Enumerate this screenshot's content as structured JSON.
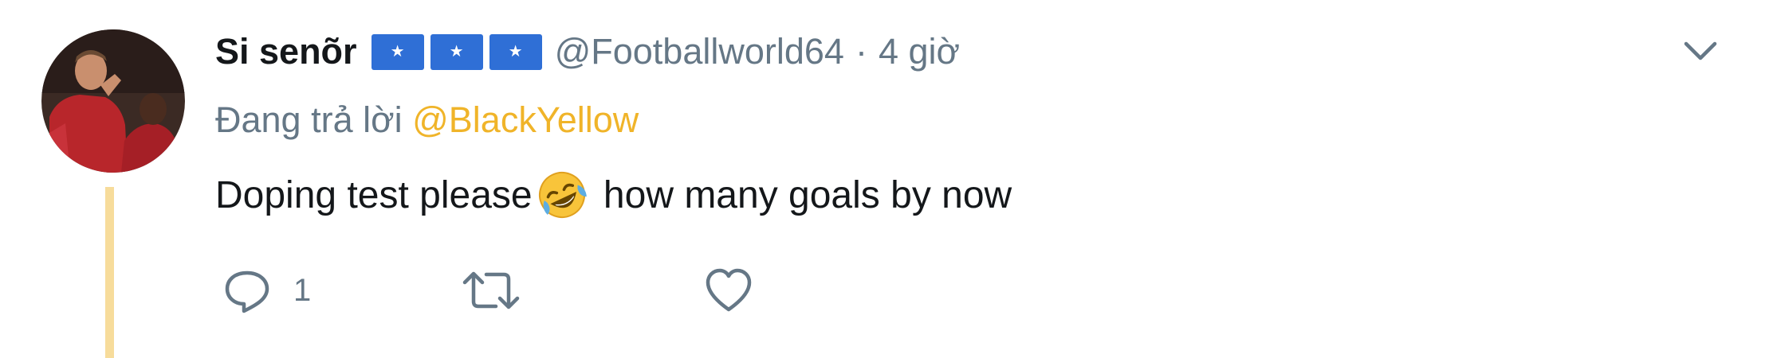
{
  "tweet": {
    "display_name": "Si senõr",
    "badges": [
      "★",
      "★",
      "★"
    ],
    "handle": "@Footballworld64",
    "separator": "·",
    "time": "4 giờ",
    "reply_prefix": "Đang trả lời ",
    "reply_mention": "@BlackYellow",
    "text_before_emoji": "Doping test please",
    "emoji": "rolling-on-floor-laughing",
    "text_after_emoji": " how many goals by now",
    "reply_count": "1",
    "colors": {
      "thread_line": "#f7dc9b",
      "mention": "#f0b429",
      "secondary_text": "#657786",
      "badge": "#2f6fd6"
    }
  },
  "icons": {
    "more": "chevron-down-icon",
    "reply": "speech-bubble-icon",
    "retweet": "retweet-icon",
    "like": "heart-icon"
  }
}
